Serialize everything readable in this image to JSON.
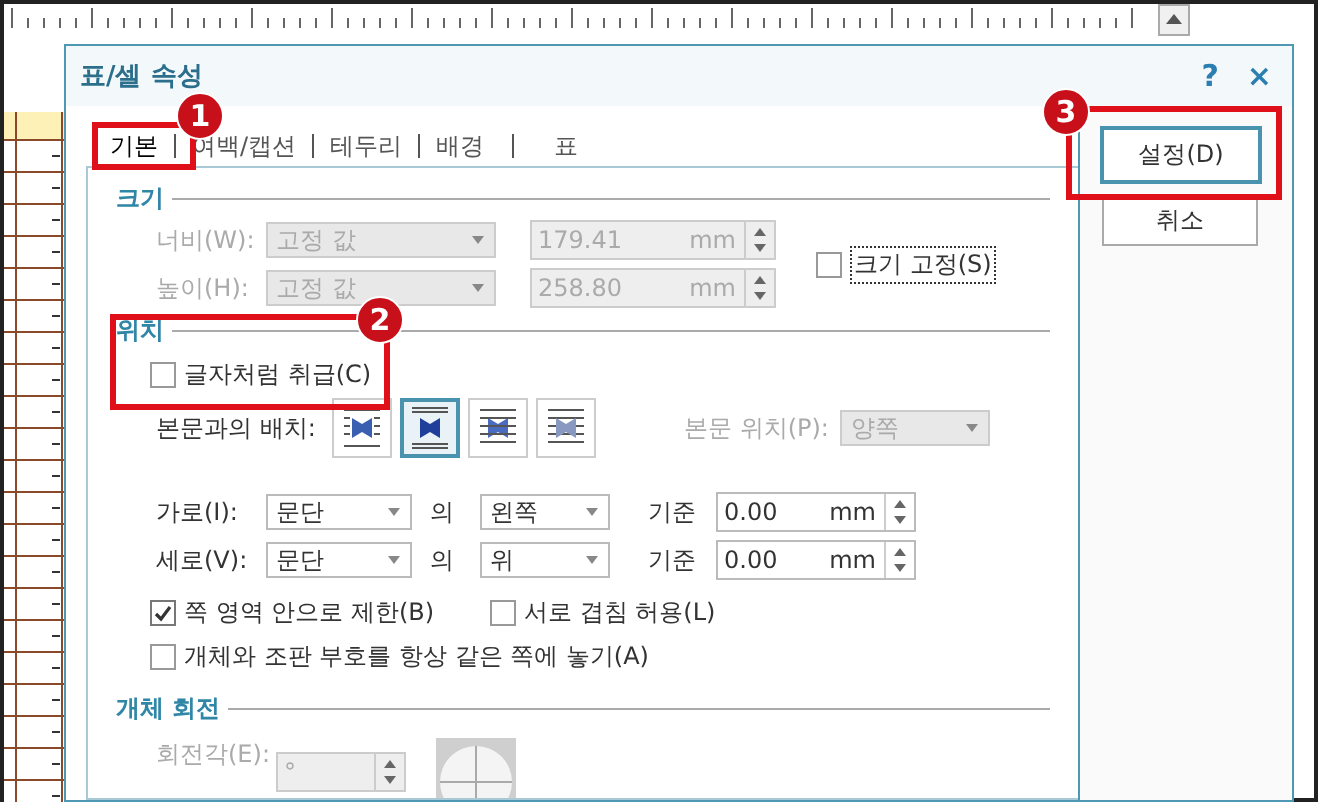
{
  "window": {
    "title": "표/셀 속성",
    "help": "?",
    "close": "×"
  },
  "tabs": [
    {
      "label": "기본",
      "selected": true
    },
    {
      "label": "여백/캡션",
      "selected": false
    },
    {
      "label": "테두리",
      "selected": false
    },
    {
      "label": "배경",
      "selected": false
    },
    {
      "label": "표",
      "selected": false
    }
  ],
  "size": {
    "title": "크기",
    "rows": [
      {
        "label": "너비(W):",
        "mode": "고정 값",
        "value": "179.41",
        "unit": "mm",
        "disabled": true
      },
      {
        "label": "높이(H):",
        "mode": "고정 값",
        "value": "258.80",
        "unit": "mm",
        "disabled": true
      }
    ],
    "lock": {
      "label": "크기 고정(S)",
      "checked": false
    }
  },
  "position": {
    "title": "위치",
    "as_char": {
      "label": "글자처럼 취급(C)",
      "checked": false
    },
    "wrap_label": "본문과의 배치:",
    "wrap_options": [
      {
        "kind": "square",
        "selected": false
      },
      {
        "kind": "topbottom",
        "selected": true
      },
      {
        "kind": "behind",
        "selected": false
      },
      {
        "kind": "front",
        "selected": false
      }
    ],
    "text_position": {
      "label": "본문 위치(P):",
      "value": "양쪽",
      "disabled": true
    },
    "offsets": [
      {
        "label": "가로(I):",
        "ref": "문단",
        "of": "의",
        "side": "왼쪽",
        "basis": "기준",
        "value": "0.00",
        "unit": "mm"
      },
      {
        "label": "세로(V):",
        "ref": "문단",
        "of": "의",
        "side": "위",
        "basis": "기준",
        "value": "0.00",
        "unit": "mm"
      }
    ],
    "options": [
      {
        "label": "쪽 영역 안으로 제한(B)",
        "checked": true
      },
      {
        "label": "서로 겹침 허용(L)",
        "checked": false
      },
      {
        "label": "개체와 조판 부호를 항상 같은 쪽에 놓기(A)",
        "checked": false
      }
    ]
  },
  "rotation": {
    "title": "개체 회전",
    "label": "회전각(E):",
    "value": "°",
    "disabled": true
  },
  "buttons": [
    {
      "label": "설정(D)",
      "default": true
    },
    {
      "label": "취소",
      "default": false
    }
  ],
  "annotations": [
    {
      "number": "1"
    },
    {
      "number": "2"
    },
    {
      "number": "3"
    }
  ]
}
